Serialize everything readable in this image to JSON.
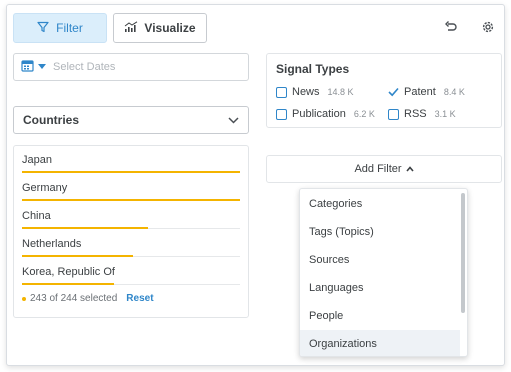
{
  "toolbar": {
    "filter_label": "Filter",
    "visualize_label": "Visualize"
  },
  "date": {
    "placeholder": "Select Dates"
  },
  "countries": {
    "label": "Countries",
    "items": [
      {
        "name": "Japan",
        "fraction": 1.0
      },
      {
        "name": "Germany",
        "fraction": 1.0
      },
      {
        "name": "China",
        "fraction": 0.58
      },
      {
        "name": "Netherlands",
        "fraction": 0.51
      },
      {
        "name": "Korea, Republic Of",
        "fraction": 0.42
      }
    ],
    "selection_status": "243 of 244 selected",
    "reset_label": "Reset"
  },
  "signal_types": {
    "title": "Signal Types",
    "options": [
      {
        "label": "News",
        "count": "14.8 K",
        "checked": false
      },
      {
        "label": "Patent",
        "count": "8.4 K",
        "checked": true
      },
      {
        "label": "Publication",
        "count": "6.2 K",
        "checked": false
      },
      {
        "label": "RSS",
        "count": "3.1 K",
        "checked": false
      }
    ]
  },
  "add_filter": {
    "label": "Add Filter",
    "menu_items": [
      "Categories",
      "Tags (Topics)",
      "Sources",
      "Languages",
      "People",
      "Organizations"
    ],
    "hovered_item": "Organizations"
  },
  "colors": {
    "accent": "#2f86c9",
    "bar": "#f4b400"
  }
}
